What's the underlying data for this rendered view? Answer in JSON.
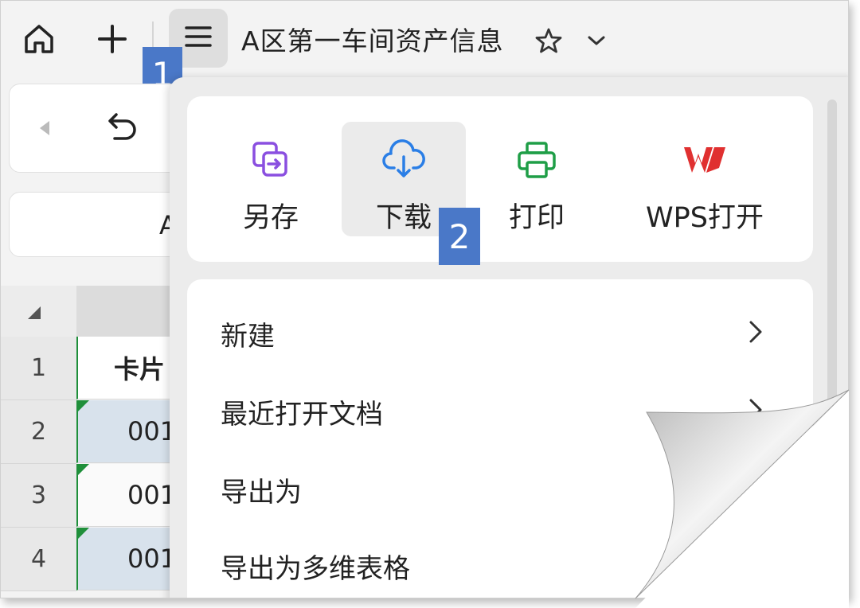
{
  "topbar": {
    "icons": [
      "home-icon",
      "plus-icon",
      "menu-icon",
      "star-icon",
      "chevron-down-icon"
    ],
    "doc_title": "A区第一车间资产信息"
  },
  "steps": {
    "step1": "1",
    "step2": "2"
  },
  "left_toolbar": {
    "icons": [
      "left-arrow-icon",
      "undo-icon"
    ],
    "partial_text": "A"
  },
  "sheet": {
    "rows": [
      {
        "num": "1",
        "value": "卡片"
      },
      {
        "num": "2",
        "value": "001"
      },
      {
        "num": "3",
        "value": "001"
      },
      {
        "num": "4",
        "value": "001"
      }
    ]
  },
  "menu": {
    "quick_actions": [
      {
        "label": "另存",
        "icon": "save-as-icon",
        "color": "#8a4fe0"
      },
      {
        "label": "下载",
        "icon": "cloud-download-icon",
        "color": "#2a7ee6"
      },
      {
        "label": "打印",
        "icon": "printer-icon",
        "color": "#1f9e47"
      },
      {
        "label": "WPS打开",
        "icon": "wps-logo-icon",
        "color": "#e03030"
      }
    ],
    "items": [
      {
        "label": "新建",
        "has_submenu": true
      },
      {
        "label": "最近打开文档",
        "has_submenu": true
      },
      {
        "label": "导出为",
        "has_submenu": false
      },
      {
        "label": "导出为多维表格",
        "has_submenu": false
      }
    ]
  },
  "colors": {
    "badge": "#4a78c8",
    "sheet_green": "#1f8f3a",
    "cell_blue": "#d8e2ec"
  }
}
